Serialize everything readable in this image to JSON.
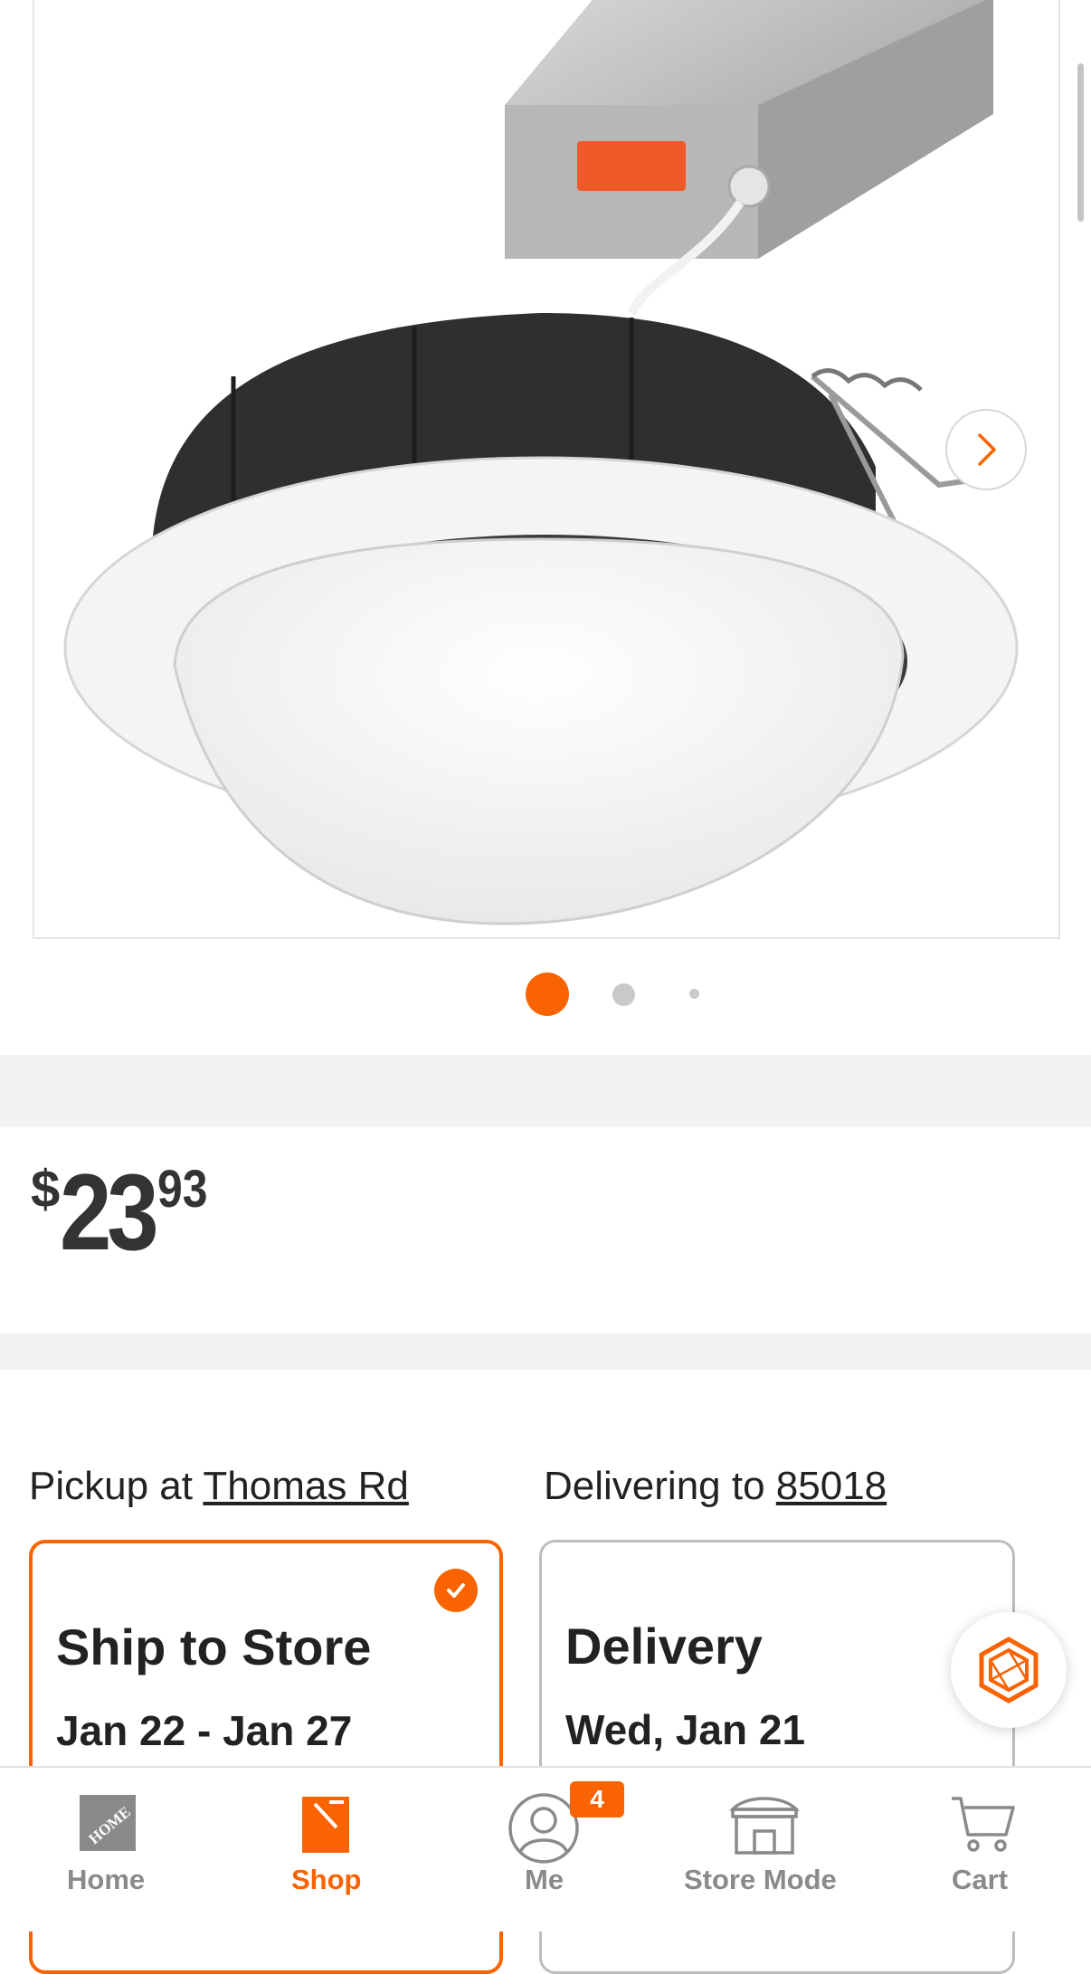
{
  "product": {
    "price_currency": "$",
    "price_dollars": "23",
    "price_cents": "93",
    "carousel_total": 3,
    "carousel_active": 1
  },
  "fulfillment": {
    "pickup_prefix": "Pickup at",
    "pickup_store": "Thomas Rd",
    "delivery_prefix": "Delivering to",
    "delivery_zip": "85018",
    "options": [
      {
        "title": "Ship to Store",
        "date": "Jan 22 - Jan 27",
        "selected": true
      },
      {
        "title": "Delivery",
        "date": "Wed, Jan 21",
        "selected": false
      }
    ]
  },
  "bottom_nav": {
    "items": [
      {
        "label": "Home",
        "icon": "home-depot-logo-icon",
        "active": false
      },
      {
        "label": "Shop",
        "icon": "paint-bucket-icon",
        "active": true
      },
      {
        "label": "Me",
        "icon": "user-profile-icon",
        "active": false
      },
      {
        "label": "Store Mode",
        "icon": "storefront-icon",
        "active": false
      },
      {
        "label": "Cart",
        "icon": "cart-icon",
        "active": false
      }
    ],
    "me_badge": "4"
  },
  "colors": {
    "brand_orange": "#f96302",
    "inactive_gray": "#8a8a8a",
    "band_gray": "#f2f2f2"
  }
}
